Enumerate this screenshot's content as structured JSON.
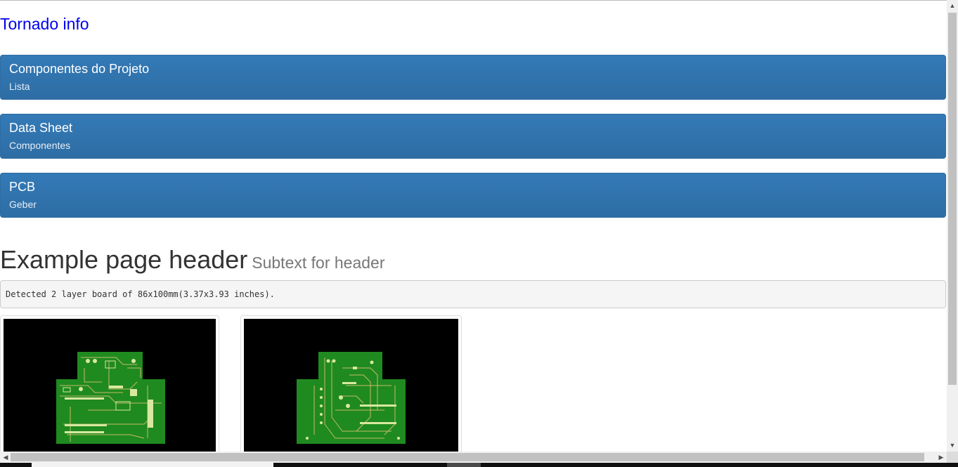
{
  "nav": {
    "brand": "Tornado info"
  },
  "panels": [
    {
      "title": "Componentes do Projeto",
      "subtitle": "Lista"
    },
    {
      "title": "Data Sheet",
      "subtitle": "Componentes"
    },
    {
      "title": "PCB",
      "subtitle": "Geber"
    }
  ],
  "header": {
    "title": "Example page header",
    "subtext": "Subtext for header"
  },
  "detection": {
    "text": "Detected 2 layer board of 86x100mm(3.37x3.93 inches)."
  },
  "images": [
    {
      "icon": "pcb-top-layer-image"
    },
    {
      "icon": "pcb-bottom-layer-image"
    }
  ],
  "colors": {
    "panel": "#337ab7",
    "link": "#0000ee",
    "pcb_green": "#1f8a1f",
    "pcb_trace": "#d8c070"
  }
}
